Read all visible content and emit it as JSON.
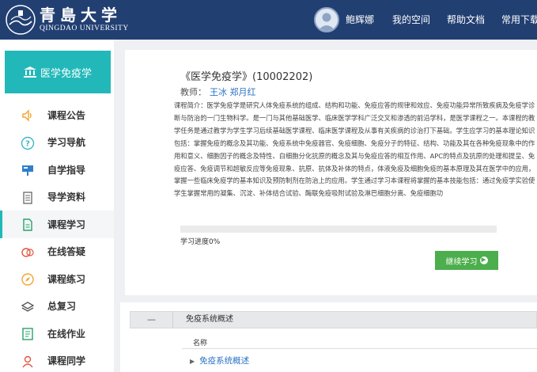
{
  "header": {
    "logo_cn": "青島大学",
    "logo_en": "QINGDAO UNIVERSITY",
    "user_name": "鲍辉娜",
    "nav": [
      "我的空间",
      "帮助文档",
      "常用下载"
    ]
  },
  "sidebar": {
    "course_name": "医学免疫学",
    "items": [
      {
        "label": "课程公告",
        "icon": "speaker-icon"
      },
      {
        "label": "学习导航",
        "icon": "question-circle-icon"
      },
      {
        "label": "自学指导",
        "icon": "guide-board-icon"
      },
      {
        "label": "导学资料",
        "icon": "document-list-icon"
      },
      {
        "label": "课程学习",
        "icon": "document-icon"
      },
      {
        "label": "在线答疑",
        "icon": "chat-bubbles-icon"
      },
      {
        "label": "课程练习",
        "icon": "compass-icon"
      },
      {
        "label": "总复习",
        "icon": "layers-icon"
      },
      {
        "label": "在线作业",
        "icon": "checklist-icon"
      },
      {
        "label": "课程同学",
        "icon": "classmates-icon"
      }
    ],
    "active_index": 4
  },
  "course": {
    "title": "《医学免疫学》(10002202)",
    "teacher_label": "教师：",
    "teachers": "王冰 郑月红",
    "intro": "课程简介：医学免疫学是研究人体免疫系统的组成、结构和功能、免疫应答的规律和效应、免疫功能异常所致疾病及免疫学诊断与防治的一门生物科学。是一门与其他基础医学、临床医学学科广泛交叉和渗透的前沿学科，是医学课程之一。本课程的教学任务是通过教学为学生学习后续基础医学课程、临床医学课程及从事有关疾病的诊治打下基础。学生应学习的基本理论知识包括：掌握免疫的概念及其功能、免疫系统中免疫器官、免疫细胞、免疫分子的特征、结构、功能及其在各种免疫现象中的作用和意义、细胞因子的概念及特性、白细胞分化抗原的概念及其与免疫应答的相互作用、APC的特点及抗原的处理和提呈、免疫应答、免疫调节和超敏反应等免疫现象、抗原、抗体及补体的特点，体液免疫及细胞免疫的基本原理及其在医学中的应用，掌握一些临床免疫学的基本知识及预防制剂在防治上的应用。学生通过学习本课程将掌握的基本技能包括：通过免疫学实验使学生掌握常用的凝集、沉淀、补体结合试验、酶联免疫吸附试验及淋巴细胞分离、免疫细胞功"
  },
  "progress": {
    "label": "学习进度",
    "value": "0%",
    "fraction": 0
  },
  "continue_button": "继续学习",
  "chapter": {
    "toggle": "—",
    "name": "免疫系统概述",
    "column_header": "名称",
    "lessons": [
      "免疫系统概述"
    ]
  },
  "colors": {
    "header_bg": "#223f72",
    "accent_teal": "#22b8b9",
    "button_green": "#4cae4c",
    "link_blue": "#2b73c4"
  }
}
